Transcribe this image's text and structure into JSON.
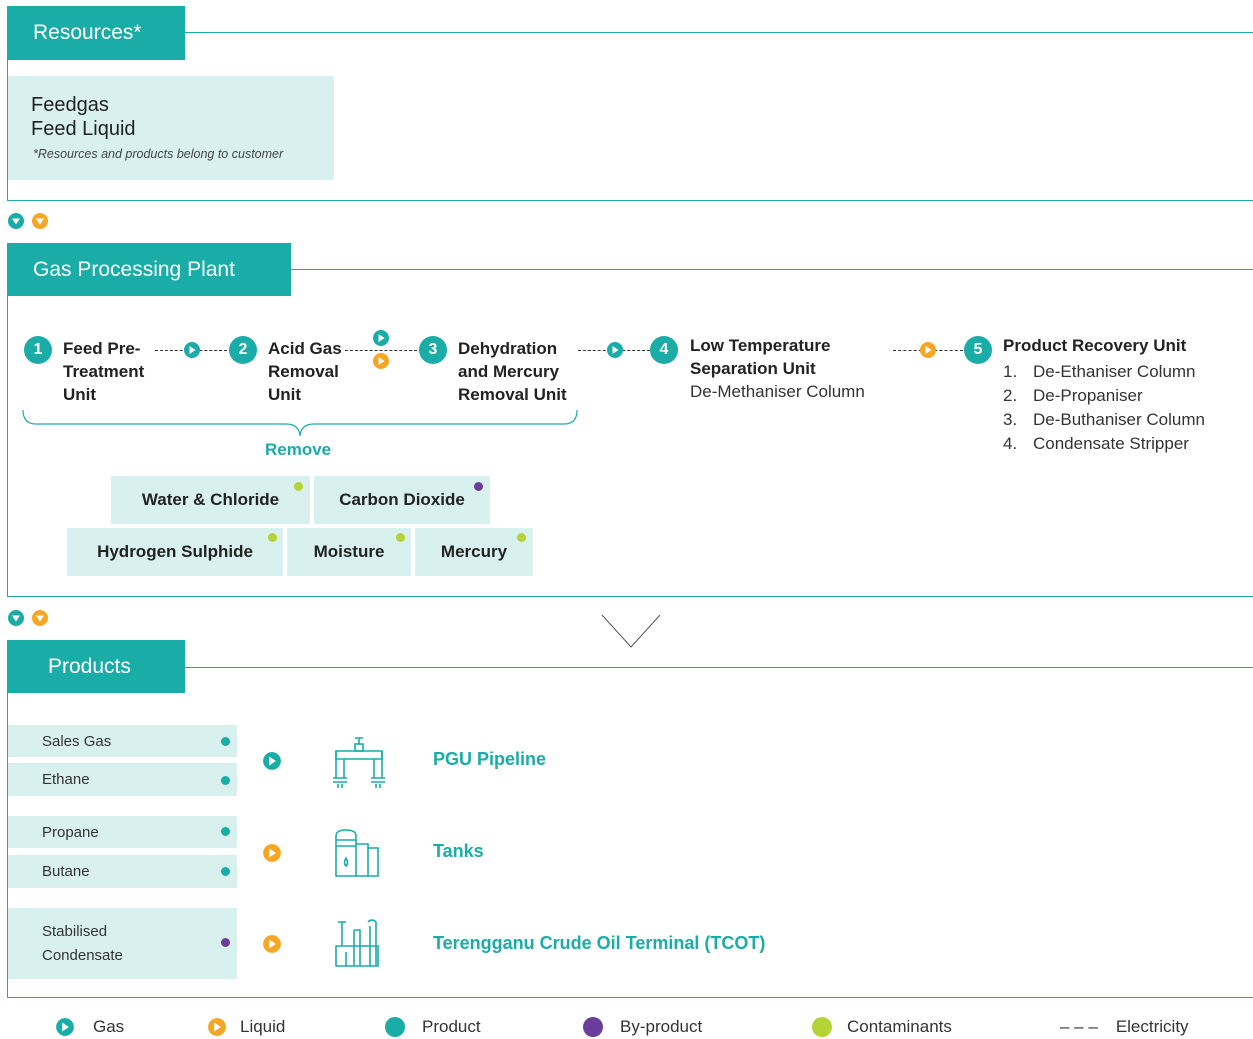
{
  "colors": {
    "teal": "#1aaca6",
    "orange": "#f5a623",
    "purple": "#6a3d9a",
    "lime": "#b5d334",
    "light_teal": "#d8f1ef"
  },
  "resources": {
    "title": "Resources*",
    "lines": [
      "Feedgas",
      "Feed Liquid"
    ],
    "note": "*Resources and products belong to customer"
  },
  "plant": {
    "title": "Gas Processing Plant",
    "steps": [
      {
        "num": "1",
        "label": "Feed Pre-\nTreatment\nUnit"
      },
      {
        "num": "2",
        "label": "Acid Gas\nRemoval\nUnit"
      },
      {
        "num": "3",
        "label": "Dehydration\nand Mercury\nRemoval Unit"
      },
      {
        "num": "4",
        "label": "Low Temperature\nSeparation Unit",
        "sub": "De-Methaniser Column"
      },
      {
        "num": "5",
        "label": "Product Recovery Unit",
        "sub_list": [
          "De-Ethaniser Column",
          "De-Propaniser",
          "De-Buthaniser Column",
          "Condensate Stripper"
        ]
      }
    ],
    "remove_label": "Remove",
    "contaminants": [
      "Water & Chloride",
      "Carbon Dioxide",
      "Hydrogen Sulphide",
      "Moisture",
      "Mercury"
    ]
  },
  "products": {
    "title": "Products",
    "items": [
      "Sales Gas",
      "Ethane",
      "Propane",
      "Butane",
      "Stabilised\nCondensate"
    ],
    "destinations": [
      "PGU Pipeline",
      "Tanks",
      "Terengganu Crude Oil Terminal (TCOT)"
    ]
  },
  "legend": {
    "gas": "Gas",
    "liquid": "Liquid",
    "product": "Product",
    "byproduct": "By-product",
    "contaminants": "Contaminants",
    "electricity_symbol": "– – –",
    "electricity": "Electricity"
  },
  "icons": [
    "gas-play-icon",
    "liquid-play-icon",
    "pipeline-icon",
    "tank-icon",
    "terminal-icon",
    "chevron-down-icon"
  ]
}
